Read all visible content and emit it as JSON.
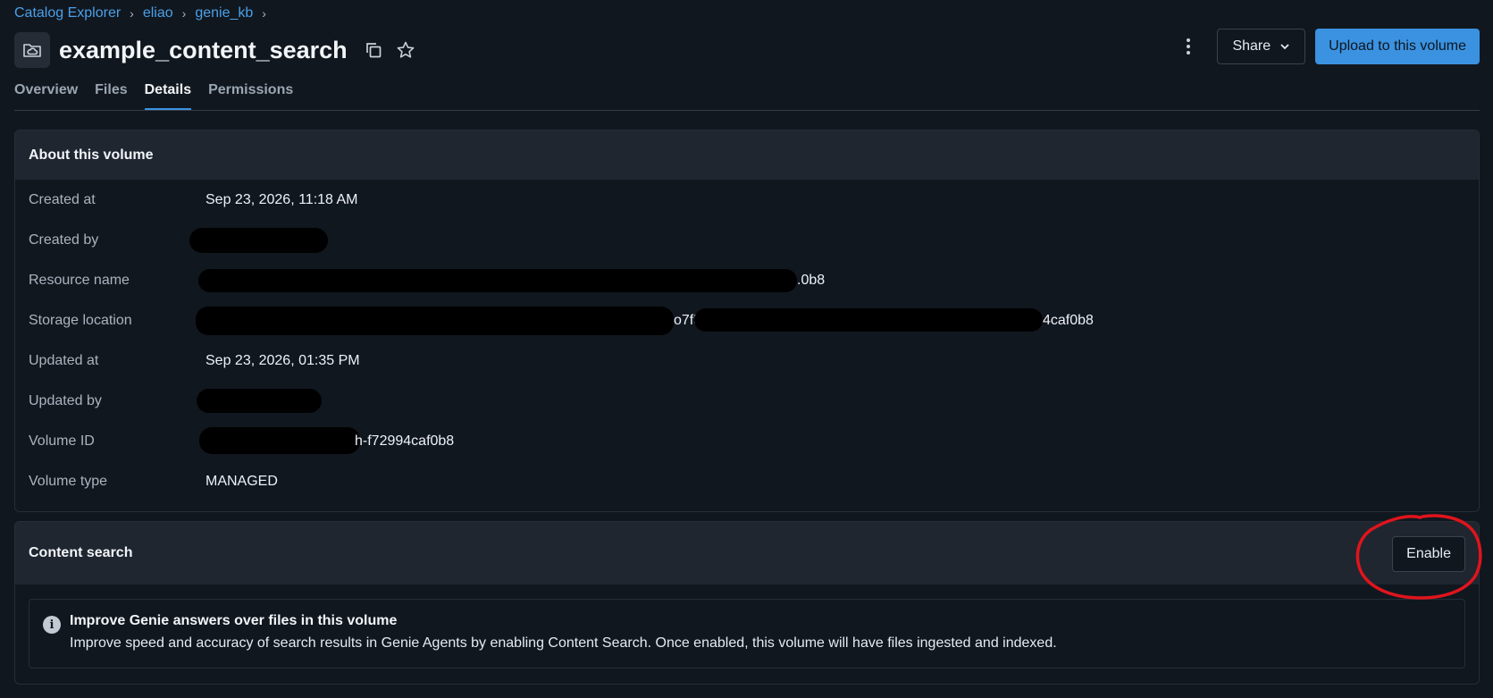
{
  "breadcrumb": {
    "items": [
      "Catalog Explorer",
      "eliao",
      "genie_kb"
    ],
    "separator": "›"
  },
  "header": {
    "title": "example_content_search",
    "share_label": "Share",
    "upload_label": "Upload to this volume"
  },
  "tabs": [
    {
      "label": "Overview",
      "active": false
    },
    {
      "label": "Files",
      "active": false
    },
    {
      "label": "Details",
      "active": true
    },
    {
      "label": "Permissions",
      "active": false
    }
  ],
  "details": {
    "title": "About this volume",
    "rows": [
      {
        "label": "Created at",
        "value": "Sep 23, 2026, 11:18 AM"
      },
      {
        "label": "Created by",
        "value": ""
      },
      {
        "label": "Resource name",
        "value": ".0b8"
      },
      {
        "label": "Storage location",
        "value_a": "o7f5",
        "value_b": "4caf0b8"
      },
      {
        "label": "Updated at",
        "value": "Sep 23, 2026, 01:35 PM"
      },
      {
        "label": "Updated by",
        "value": ""
      },
      {
        "label": "Volume ID",
        "value": "h-f72994caf0b8"
      },
      {
        "label": "Volume type",
        "value": "MANAGED"
      }
    ]
  },
  "content_search": {
    "title": "Content search",
    "enable_label": "Enable",
    "info_title": "Improve Genie answers over files in this volume",
    "info_body": "Improve speed and accuracy of search results in Genie Agents by enabling Content Search. Once enabled, this volume will have files ingested and indexed."
  },
  "colors": {
    "background": "#11171f",
    "panel_header": "#1f2630",
    "accent_blue": "#3b92e0",
    "link_blue": "#4aa0e8",
    "annotation_red": "#e0141c"
  },
  "icons": [
    "folder-cloud-icon",
    "copy-icon",
    "star-icon",
    "kebab-menu-icon",
    "chevron-down-icon",
    "info-icon"
  ]
}
